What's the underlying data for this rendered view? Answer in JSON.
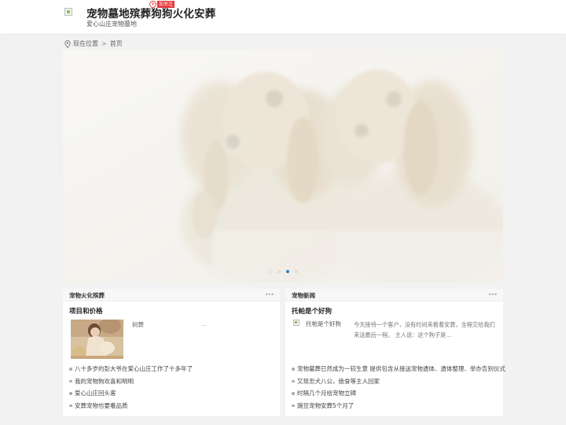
{
  "header": {
    "title": "宠物墓地殡葬狗狗火化安葬",
    "follow_label": "加关注",
    "follow_icon": "plus-circle-icon",
    "subtitle": "爱心山庄宠物墓地"
  },
  "breadcrumb": {
    "label": "现在位置",
    "separator": ">",
    "home": "首页"
  },
  "banner": {
    "slide_count": 4,
    "active_slide": 3,
    "accent_color": "#2c80c5"
  },
  "left_panel": {
    "title": "宠物火化殡葬",
    "more": "•••",
    "subtitle": "项目和价格",
    "product_name": "树葬",
    "ellipsis": "...",
    "items": [
      "八十多岁的彭大爷在爱心山庄工作了十多年了",
      "我的宠物狗欢喜和明明",
      "爱心山庄回头客",
      "安葬宠物也要看品质"
    ]
  },
  "right_panel": {
    "title": "宠物新闻",
    "more": "•••",
    "subtitle": "托帕是个好狗",
    "image_alt": "托帕是个好狗",
    "summary": "今天接待一个客户，没有时间来看着安葬，全程交给我们来送最后一程。 主人说：这个狗子是...",
    "items": [
      "宠物墓葬已然成为一较生意 提供包含从接送宠物遗体、遗体整理、举办告别仪式",
      "又现忠犬八公，绝食等主人回家",
      "时隔几个月给宠物立碑",
      "豌豆宠物安葬5个月了"
    ]
  }
}
